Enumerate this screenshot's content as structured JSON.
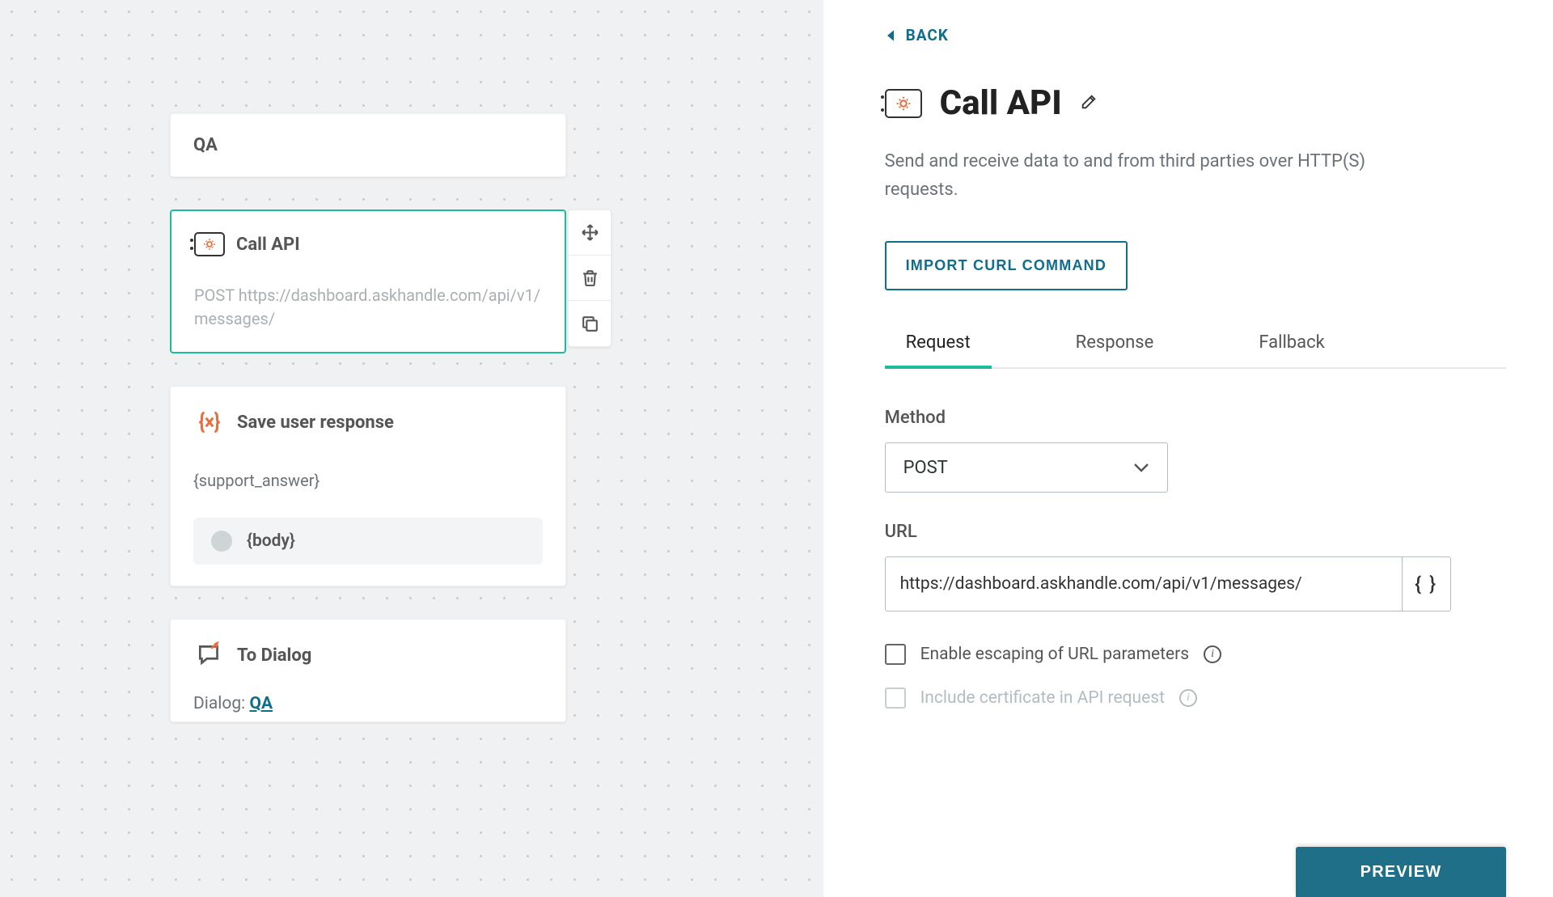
{
  "canvas": {
    "header": {
      "title": "QA"
    },
    "nodes": {
      "call_api": {
        "title": "Call API",
        "subtitle": "POST https://dashboard.askhandle.com/api/v1/messages/"
      },
      "save_response": {
        "title": "Save user response",
        "variable": "{support_answer}",
        "chip": "{body}"
      },
      "to_dialog": {
        "title": "To Dialog",
        "link_label": "Dialog: ",
        "link_target": "QA"
      }
    }
  },
  "panel": {
    "back_label": "BACK",
    "title": "Call API",
    "description": "Send and receive data to and from third parties over HTTP(S) requests.",
    "import_button": "IMPORT CURL COMMAND",
    "tabs": {
      "request": "Request",
      "response": "Response",
      "fallback": "Fallback"
    },
    "form": {
      "method_label": "Method",
      "method_value": "POST",
      "url_label": "URL",
      "url_value": "https://dashboard.askhandle.com/api/v1/messages/",
      "variable_glyph": "{ }",
      "escape_label": "Enable escaping of URL parameters",
      "cert_label": "Include certificate in API request"
    },
    "preview_button": "PREVIEW"
  }
}
